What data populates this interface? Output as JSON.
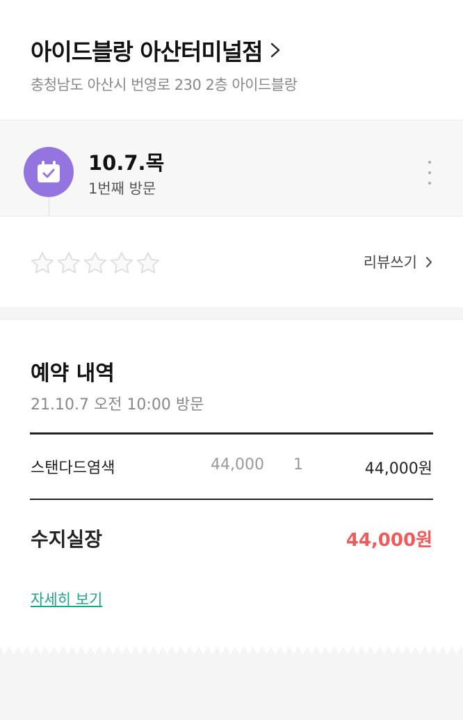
{
  "store": {
    "name": "아이드블랑 아산터미널점",
    "address": "충청남도 아산시 번영로 230 2층 아이드블랑"
  },
  "visit": {
    "date": "10.7.목",
    "count": "1번째 방문"
  },
  "review": {
    "rating": 0,
    "max_rating": 5,
    "write_label": "리뷰쓰기"
  },
  "booking": {
    "title": "예약 내역",
    "datetime": "21.10.7 오전 10:00 방문",
    "items": [
      {
        "name": "스탠다드염색",
        "price": "44,000",
        "quantity": "1",
        "total": "44,000원"
      }
    ],
    "payment_method": "수지실장",
    "payment_total": "44,000원",
    "details_label": "자세히 보기"
  },
  "colors": {
    "accent_purple": "#9474de",
    "price_red": "#f05a5a",
    "link_teal": "#1aa58c"
  },
  "icons": {
    "calendar": "calendar-check-icon",
    "more": "more-vertical-icon",
    "chevron": "chevron-right-icon",
    "star": "star-outline-icon"
  }
}
